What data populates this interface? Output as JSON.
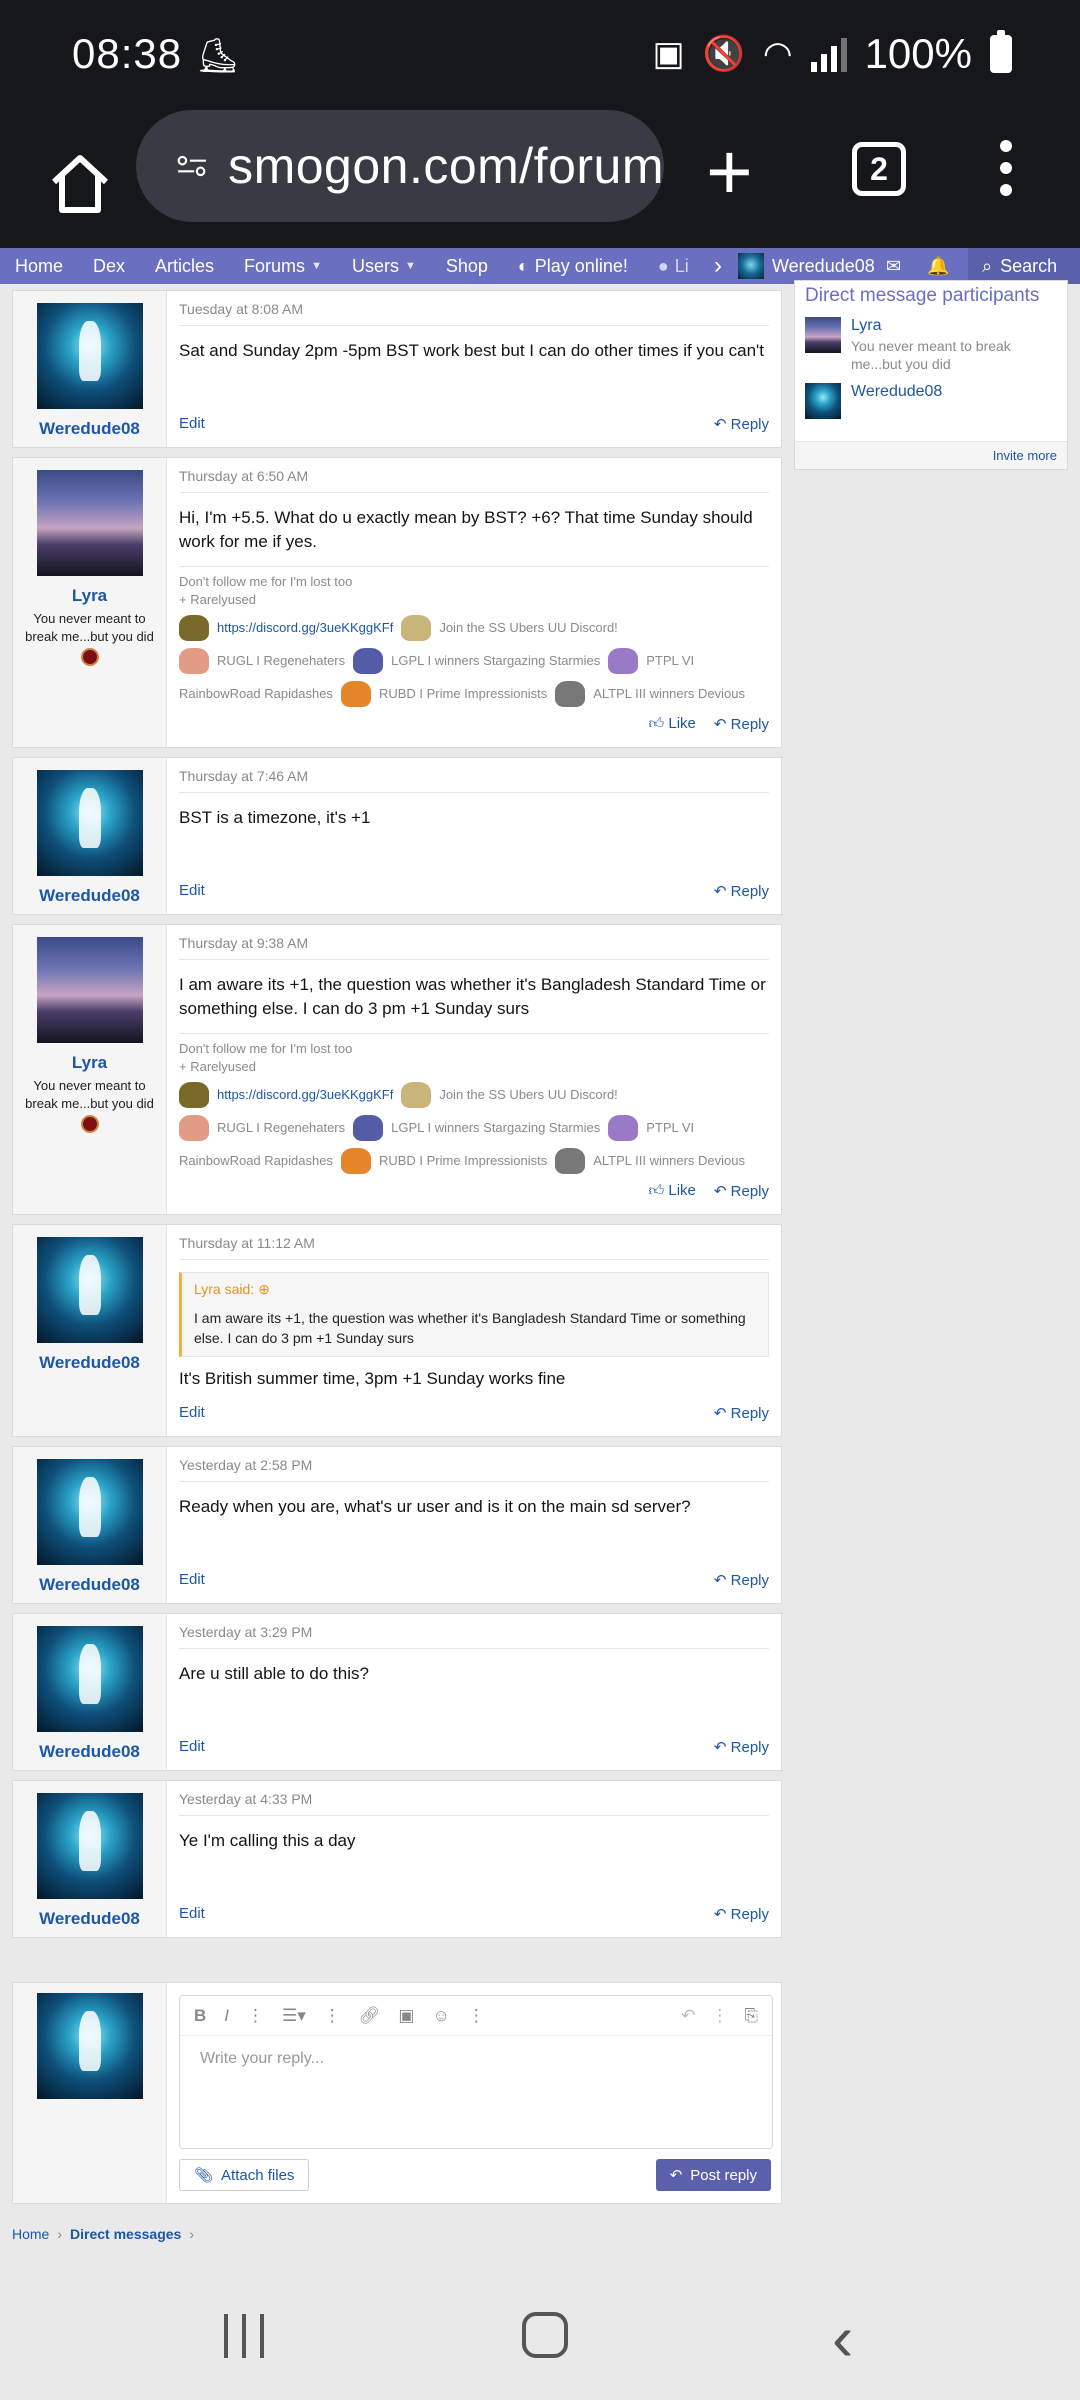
{
  "status_bar": {
    "time": "08:38",
    "battery": "100%"
  },
  "browser": {
    "url": "smogon.com/forum",
    "tab_count": "2"
  },
  "forum_nav": {
    "items": [
      "Home",
      "Dex",
      "Articles",
      "Forums",
      "Users",
      "Shop",
      "Play online!",
      "Li"
    ],
    "username": "Weredude08",
    "search_label": "Search"
  },
  "messages": [
    {
      "date": "Tuesday at 8:08 AM",
      "user": "Weredude08",
      "text": "Sat and Sunday 2pm -5pm BST work best but I can do other times if you can't",
      "left_action": "Edit",
      "like": "",
      "reply": "Reply"
    },
    {
      "date": "Thursday at 6:50 AM",
      "user": "Lyra",
      "user_title": "You never meant to break me...but you did",
      "text": "Hi, I'm +5.5. What do u exactly mean by BST? +6? That time Sunday should work for me if yes.",
      "left_action": "",
      "like": "Like",
      "reply": "Reply"
    },
    {
      "date": "Thursday at 7:46 AM",
      "user": "Weredude08",
      "text": "BST is a timezone, it's +1",
      "left_action": "Edit",
      "like": "",
      "reply": "Reply"
    },
    {
      "date": "Thursday at 9:38 AM",
      "user": "Lyra",
      "user_title": "You never meant to break me...but you did",
      "text": "I am aware its +1, the question was whether it's Bangladesh Standard Time or something else. I can do 3 pm +1 Sunday surs",
      "left_action": "",
      "like": "Like",
      "reply": "Reply"
    },
    {
      "date": "Thursday at 11:12 AM",
      "user": "Weredude08",
      "quote_head": "Lyra said:",
      "quote_text": "I am aware its +1, the question was whether it's Bangladesh Standard Time or something else. I can do 3 pm +1 Sunday surs",
      "text": "It's British summer time, 3pm +1 Sunday works fine",
      "left_action": "Edit",
      "like": "",
      "reply": "Reply"
    },
    {
      "date": "Yesterday at 2:58 PM",
      "user": "Weredude08",
      "text": "Ready when you are, what's ur user and is it on the main sd server?",
      "left_action": "Edit",
      "like": "",
      "reply": "Reply"
    },
    {
      "date": "Yesterday at 3:29 PM",
      "user": "Weredude08",
      "text": "Are u still able to do this?",
      "left_action": "Edit",
      "like": "",
      "reply": "Reply"
    },
    {
      "date": "Yesterday at 4:33 PM",
      "user": "Weredude08",
      "text": "Ye I'm calling this a day",
      "left_action": "Edit",
      "like": "",
      "reply": "Reply"
    }
  ],
  "signature": {
    "line1": "Don't follow me for I'm lost too",
    "line2": "+ Rarelyused",
    "discord_link": "https://discord.gg/3ueKKggKFf",
    "discord_text": "Join the SS Ubers UU Discord!",
    "team1": "RUGL I Regenehaters",
    "team2": "LGPL I winners Stargazing Starmies",
    "team3": "PTPL VI",
    "team4": "RainbowRoad Rapidashes",
    "team5": "RUBD I Prime Impressionists",
    "team6": "ALTPL III winners Devious"
  },
  "editor": {
    "placeholder": "Write your reply...",
    "attach": "Attach files",
    "post": "Post reply"
  },
  "breadcrumb": {
    "home": "Home",
    "current": "Direct messages"
  },
  "sidebar": {
    "title": "Direct message participants",
    "participants": [
      {
        "name": "Lyra",
        "title": "You never meant to break me...but you did"
      },
      {
        "name": "Weredude08"
      }
    ],
    "invite": "Invite more"
  }
}
